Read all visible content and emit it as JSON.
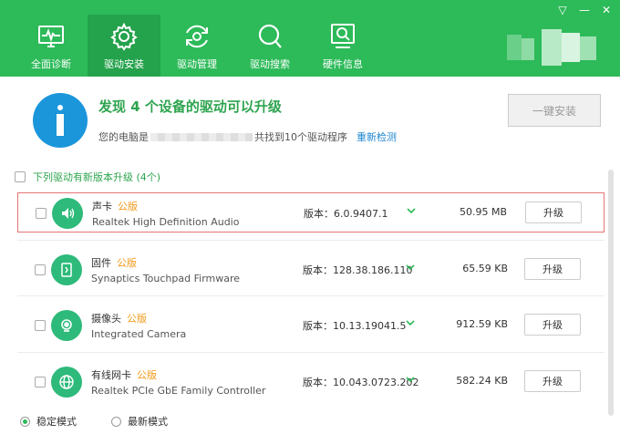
{
  "window": {
    "controls": [
      "▽",
      "—",
      "✕"
    ]
  },
  "nav": {
    "tabs": [
      {
        "label": "全面诊断",
        "icon": "monitor-pulse-icon"
      },
      {
        "label": "驱动安装",
        "icon": "gear-icon"
      },
      {
        "label": "驱动管理",
        "icon": "refresh-gear-icon"
      },
      {
        "label": "驱动搜索",
        "icon": "search-icon"
      },
      {
        "label": "硬件信息",
        "icon": "hardware-search-icon"
      }
    ]
  },
  "summary": {
    "title": "发现 4 个设备的驱动可以升级",
    "sub_prefix": "您的电脑是",
    "sub_suffix": "共找到10个驱动程序",
    "recheck": "重新检测",
    "install_all": "一键安装"
  },
  "list": {
    "header": "下列驱动有新版本升级 (4个)",
    "version_prefix": "版本：",
    "upgrade_label": "升级",
    "items": [
      {
        "type": "声卡",
        "tag": "公版",
        "model": "Realtek High Definition Audio",
        "version": "6.0.9407.1",
        "size": "50.95 MB",
        "icon": "speaker-icon"
      },
      {
        "type": "固件",
        "tag": "公版",
        "model": "Synaptics Touchpad Firmware",
        "version": "128.38.186.110",
        "size": "65.59 KB",
        "icon": "firmware-icon"
      },
      {
        "type": "摄像头",
        "tag": "公版",
        "model": "Integrated Camera",
        "version": "10.13.19041.5",
        "size": "912.59 KB",
        "icon": "camera-icon"
      },
      {
        "type": "有线网卡",
        "tag": "公版",
        "model": "Realtek PCIe GbE Family Controller",
        "version": "10.043.0723.202",
        "size": "582.24 KB",
        "icon": "globe-icon"
      }
    ]
  },
  "footer": {
    "stable_mode": "稳定模式",
    "latest_mode": "最新模式"
  },
  "colors": {
    "brand": "#2dba59",
    "info": "#1b96db",
    "tag": "#f29a1b",
    "link": "#1f86d1"
  }
}
